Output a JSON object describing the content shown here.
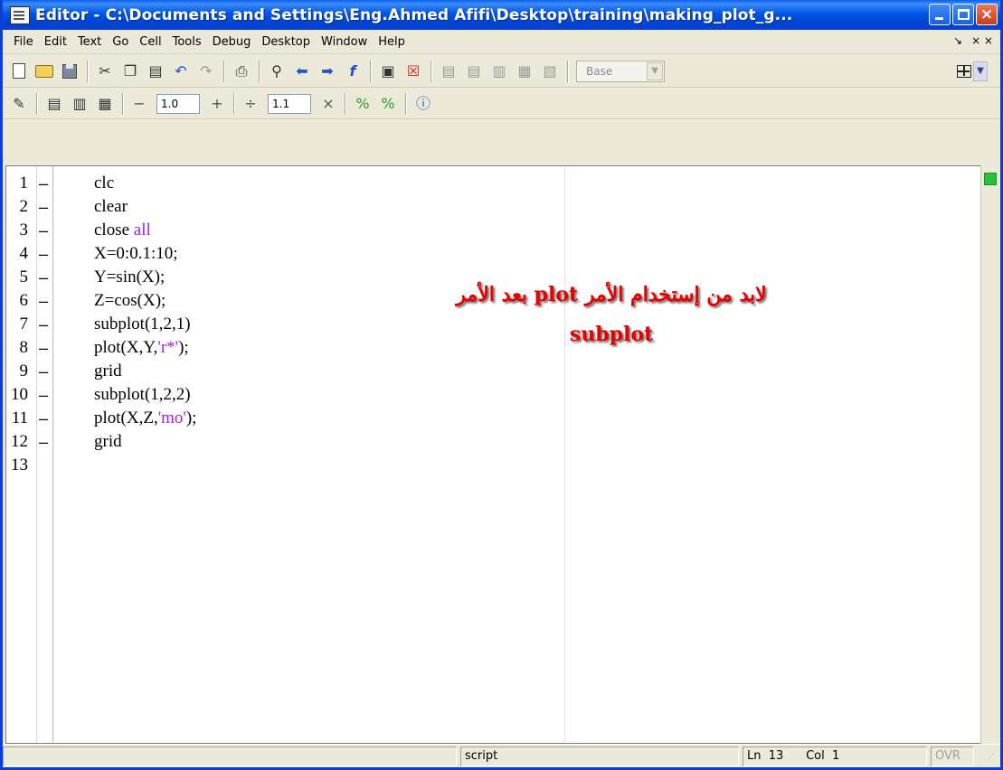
{
  "window": {
    "title": "Editor - C:\\Documents and Settings\\Eng.Ahmed Afifi\\Desktop\\training\\making_plot_g...",
    "buttons": {
      "minimize": "minimize",
      "maximize": "maximize",
      "close": "×"
    }
  },
  "menubar": {
    "items": [
      "File",
      "Edit",
      "Text",
      "Go",
      "Cell",
      "Tools",
      "Debug",
      "Desktop",
      "Window",
      "Help"
    ],
    "right": {
      "undock": "↘",
      "close": "× ×"
    }
  },
  "toolbar1": {
    "base_label": "Base",
    "icons": [
      "new-file-icon",
      "open-folder-icon",
      "save-icon",
      "cut-icon",
      "copy-icon",
      "paste-icon",
      "undo-icon",
      "redo-icon",
      "print-icon",
      "find-icon",
      "back-icon",
      "forward-icon",
      "function-icon",
      "evaluate-icon",
      "clear-breakpoint-icon",
      "set-breakpoint-icon",
      "step-icon",
      "step-in-icon",
      "step-out-icon",
      "continue-icon",
      "exit-debug-icon",
      "layout-grid-icon"
    ]
  },
  "toolbar2": {
    "field1": "1.0",
    "field2": "1.1",
    "minus": "−",
    "plus": "+",
    "divide": "÷",
    "times": "×"
  },
  "editor": {
    "lines": [
      {
        "n": "1",
        "code": "clc"
      },
      {
        "n": "2",
        "code": "clear"
      },
      {
        "n": "3",
        "code": "close ",
        "kw": "all"
      },
      {
        "n": "4",
        "code": "X=0:0.1:10;"
      },
      {
        "n": "5",
        "code": "Y=sin(X);"
      },
      {
        "n": "6",
        "code": "Z=cos(X);"
      },
      {
        "n": "7",
        "code": "subplot(1,2,1)"
      },
      {
        "n": "8",
        "code": "plot(X,Y,",
        "str": "'r*'",
        "tail": ");"
      },
      {
        "n": "9",
        "code": "grid"
      },
      {
        "n": "10",
        "code": "subplot(1,2,2)"
      },
      {
        "n": "11",
        "code": "plot(X,Z,",
        "str": "'mo'",
        "tail": ");"
      },
      {
        "n": "12",
        "code": "grid"
      },
      {
        "n": "13",
        "code": ""
      }
    ],
    "annotation_arabic": "لابد من إستخدام الأمر plot بعد الأمر",
    "annotation_english": "subplot"
  },
  "statusbar": {
    "mode": "script",
    "ln_label": "Ln",
    "ln_value": "13",
    "col_label": "Col",
    "col_value": "1",
    "ovr": "OVR"
  }
}
